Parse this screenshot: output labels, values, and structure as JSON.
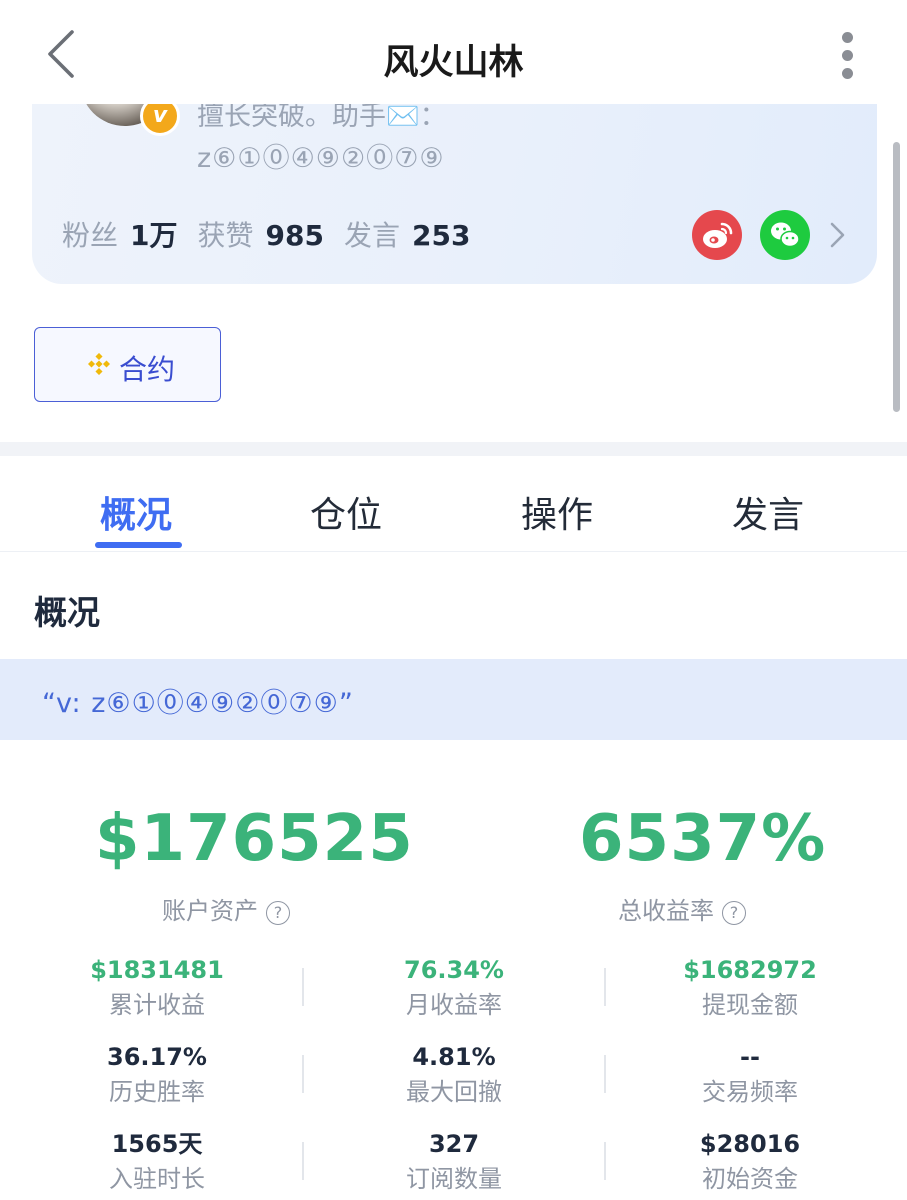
{
  "nav": {
    "title": "风火山林",
    "back_icon": "chevron-left-icon",
    "more_icon": "more-vertical-icon"
  },
  "profile": {
    "vip_badge": "v",
    "bio_line1": "擅长突破。助手✉️：",
    "bio_line2": "z⑥①⓪④⑨②⓪⑦⑨",
    "stats": {
      "fans_label": "粉丝",
      "fans_value": "1万",
      "likes_label": "获赞",
      "likes_value": "985",
      "posts_label": "发言",
      "posts_value": "253"
    },
    "social_icons": [
      "weibo-icon",
      "wechat-icon"
    ]
  },
  "tag": {
    "label": "合约",
    "icon": "binance-icon"
  },
  "tabs": [
    {
      "label": "概况",
      "active": true
    },
    {
      "label": "仓位",
      "active": false
    },
    {
      "label": "操作",
      "active": false
    },
    {
      "label": "发言",
      "active": false
    }
  ],
  "overview": {
    "title": "概况",
    "quote": "“v: z⑥①⓪④⑨②⓪⑦⑨”",
    "account_assets_value": "$176525",
    "account_assets_label": "账户资产",
    "total_return_value": "6537%",
    "total_return_label": "总收益率",
    "help_symbol": "?",
    "grid": [
      [
        {
          "value": "$1831481",
          "label": "累计收益",
          "highlight": true
        },
        {
          "value": "76.34%",
          "label": "月收益率",
          "highlight": true
        },
        {
          "value": "$1682972",
          "label": "提现金额",
          "highlight": true
        }
      ],
      [
        {
          "value": "36.17%",
          "label": "历史胜率",
          "highlight": false
        },
        {
          "value": "4.81%",
          "label": "最大回撤",
          "highlight": false
        },
        {
          "value": "--",
          "label": "交易频率",
          "highlight": false
        }
      ],
      [
        {
          "value": "1565天",
          "label": "入驻时长",
          "highlight": false
        },
        {
          "value": "327",
          "label": "订阅数量",
          "highlight": false
        },
        {
          "value": "$28016",
          "label": "初始资金",
          "highlight": false
        }
      ]
    ]
  },
  "colors": {
    "accent": "#3f6df2",
    "positive": "#3bb37a",
    "text_primary": "#1f2a3d",
    "text_secondary": "#8f96a3"
  }
}
